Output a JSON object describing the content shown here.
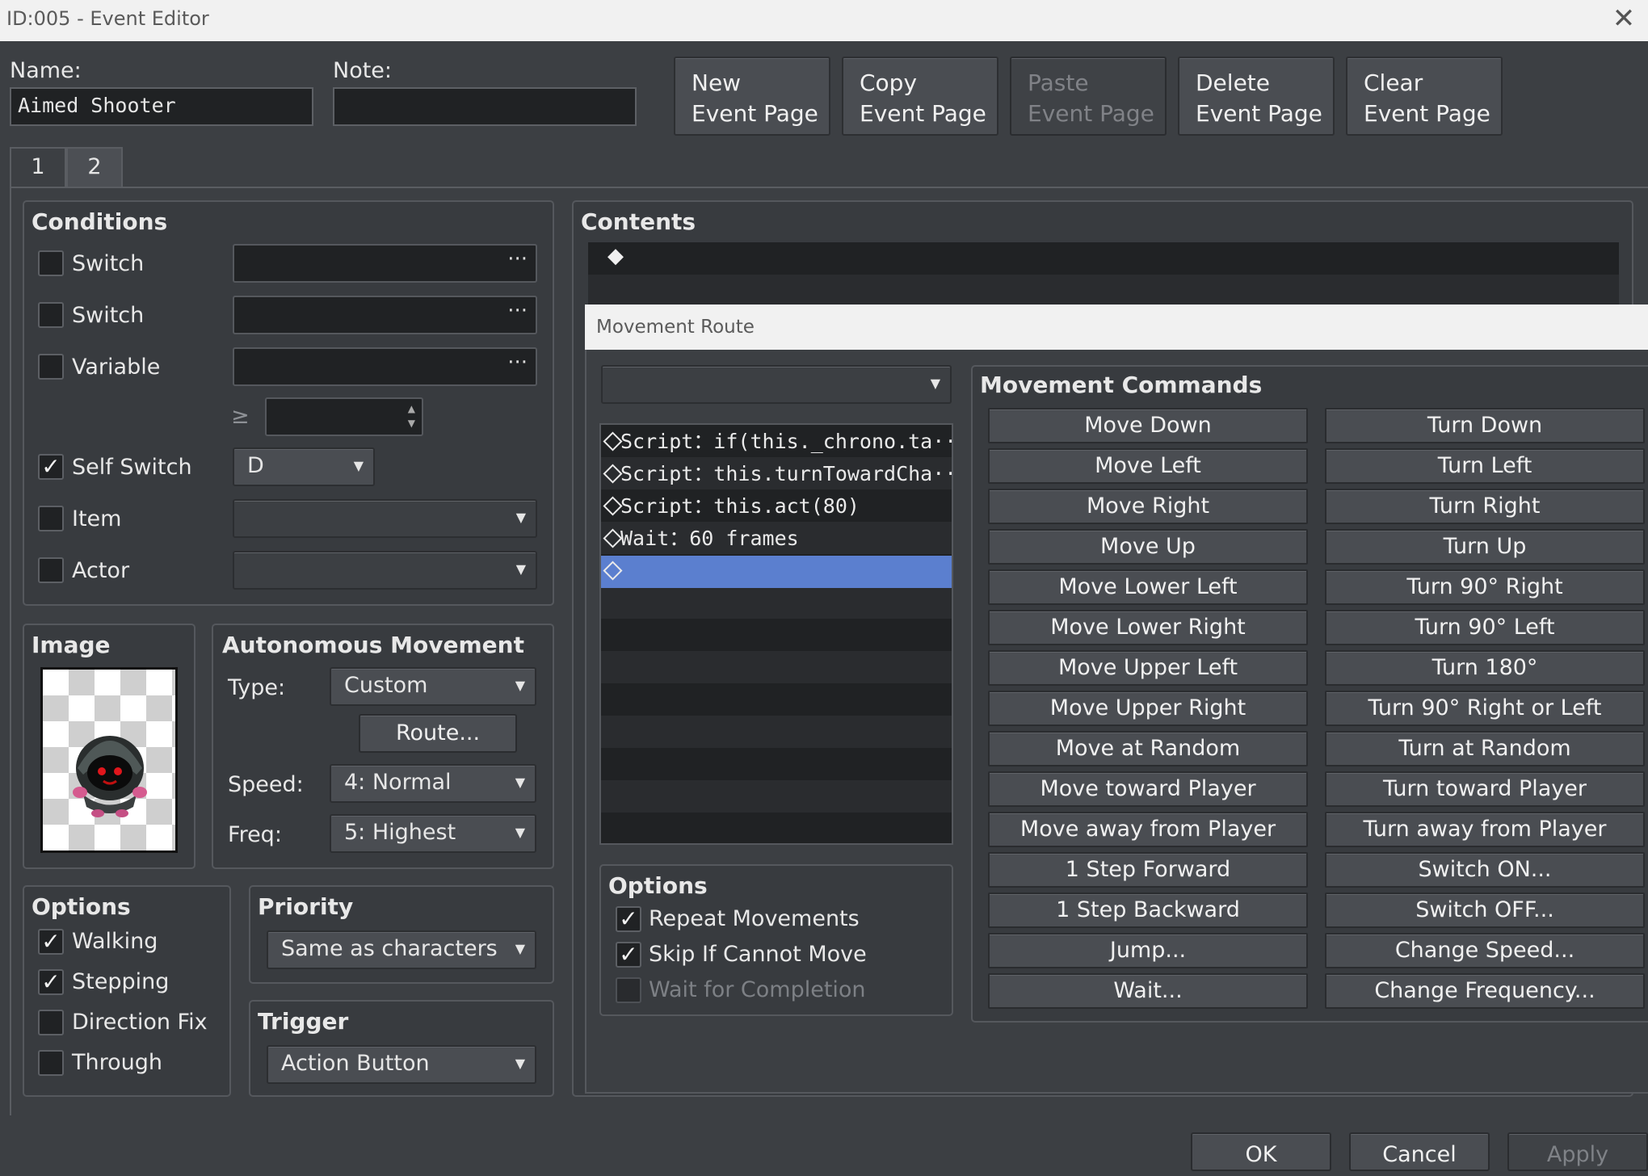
{
  "window": {
    "title": "ID:005 - Event Editor",
    "close_glyph": "✕"
  },
  "header": {
    "name_label": "Name:",
    "name_value": "Aimed Shooter",
    "note_label": "Note:",
    "note_value": "",
    "buttons": [
      {
        "line1": "New",
        "line2": "Event Page",
        "enabled": true
      },
      {
        "line1": "Copy",
        "line2": "Event Page",
        "enabled": true
      },
      {
        "line1": "Paste",
        "line2": "Event Page",
        "enabled": false
      },
      {
        "line1": "Delete",
        "line2": "Event Page",
        "enabled": true
      },
      {
        "line1": "Clear",
        "line2": "Event Page",
        "enabled": true
      }
    ]
  },
  "tabs": [
    "1",
    "2"
  ],
  "active_tab": "2",
  "conditions": {
    "title": "Conditions",
    "switch1_label": "Switch",
    "switch2_label": "Switch",
    "variable_label": "Variable",
    "ellipsis": "···",
    "gte_symbol": "≥",
    "self_switch_label": "Self Switch",
    "self_switch_value": "D",
    "item_label": "Item",
    "actor_label": "Actor",
    "check_mark": "✓"
  },
  "image": {
    "title": "Image",
    "sprite_icon": "hooded-shooter-sprite-icon"
  },
  "autonomous": {
    "title": "Autonomous Movement",
    "type_label": "Type:",
    "type_value": "Custom",
    "route_button": "Route...",
    "speed_label": "Speed:",
    "speed_value": "4: Normal",
    "freq_label": "Freq:",
    "freq_value": "5: Highest"
  },
  "options": {
    "title": "Options",
    "walking": "Walking",
    "stepping": "Stepping",
    "direction_fix": "Direction Fix",
    "through": "Through"
  },
  "priority": {
    "title": "Priority",
    "value": "Same as characters"
  },
  "trigger": {
    "title": "Trigger",
    "value": "Action Button"
  },
  "contents": {
    "title": "Contents",
    "bullet": "◆"
  },
  "movement_route": {
    "title": "Movement Route",
    "target_value": "",
    "list": [
      "Script：if(this._chrono.ta···",
      "Script：this.turnTowardCha···",
      "Script：this.act(80)",
      "Wait：60 frames",
      ""
    ],
    "options_title": "Options",
    "repeat": "Repeat Movements",
    "skip": "Skip If Cannot Move",
    "wait": "Wait for Completion",
    "commands_title": "Movement Commands",
    "commands_left": [
      "Move Down",
      "Move Left",
      "Move Right",
      "Move Up",
      "Move Lower Left",
      "Move Lower Right",
      "Move Upper Left",
      "Move Upper Right",
      "Move at Random",
      "Move toward Player",
      "Move away from Player",
      "1 Step Forward",
      "1 Step Backward",
      "Jump...",
      "Wait..."
    ],
    "commands_right": [
      "Turn Down",
      "Turn Left",
      "Turn Right",
      "Turn Up",
      "Turn 90° Right",
      "Turn 90° Left",
      "Turn 180°",
      "Turn 90° Right or Left",
      "Turn at Random",
      "Turn toward Player",
      "Turn away from Player",
      "Switch ON...",
      "Switch OFF...",
      "Change Speed...",
      "Change Frequency..."
    ]
  },
  "footer": {
    "ok": "OK",
    "cancel": "Cancel",
    "apply": "Apply"
  },
  "colors": {
    "selected_row": "#5b7fcf",
    "panel": "#3c3f43",
    "field": "#202224"
  }
}
